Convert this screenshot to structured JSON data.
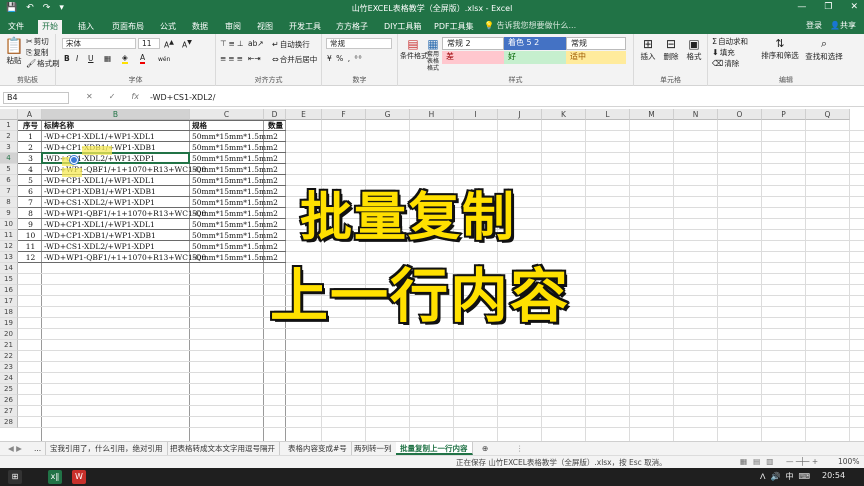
{
  "app": {
    "title": "山竹EXCEL表格教学（全屏版）.xlsx - Excel",
    "quick_access": [
      "💾",
      "↶",
      "↷",
      "▾"
    ],
    "window_controls": [
      "—",
      "❐",
      "✕"
    ]
  },
  "tabs": [
    "文件",
    "开始",
    "插入",
    "页面布局",
    "公式",
    "数据",
    "审阅",
    "视图",
    "开发工具",
    "方方格子",
    "DIY工具箱",
    "PDF工具集"
  ],
  "active_tab": "开始",
  "search_hint": "告诉我您想要做什么...",
  "account": {
    "login": "登录",
    "share": "共享"
  },
  "ribbon": {
    "clipboard": {
      "label": "剪贴板",
      "paste": "粘贴",
      "cut": "剪切",
      "copy": "复制",
      "format_painter": "格式刷"
    },
    "font": {
      "label": "字体",
      "name": "宋体",
      "size": "11",
      "bold": "B",
      "italic": "I",
      "underline": "U",
      "wen": "wén"
    },
    "alignment": {
      "label": "对齐方式",
      "wrap": "自动换行",
      "merge": "合并后居中"
    },
    "number": {
      "label": "数字",
      "format": "常规"
    },
    "styles": {
      "label": "样式",
      "conditional": "条件格式",
      "as_table": "套用表格格式",
      "cells": [
        {
          "text": "常规 2",
          "bg": "#ffffff",
          "fg": "#222222"
        },
        {
          "text": "着色 5 2",
          "bg": "#4472c4",
          "fg": "#ffffff"
        },
        {
          "text": "常规",
          "bg": "#ffffff",
          "fg": "#222222"
        },
        {
          "text": "差",
          "bg": "#ffc7ce",
          "fg": "#9c0006"
        },
        {
          "text": "好",
          "bg": "#c6efce",
          "fg": "#006100"
        },
        {
          "text": "适中",
          "bg": "#ffeb9c",
          "fg": "#9c5700"
        }
      ]
    },
    "cells_group": {
      "label": "单元格",
      "insert": "插入",
      "delete": "删除",
      "format": "格式"
    },
    "editing": {
      "label": "编辑",
      "autosum": "自动求和",
      "fill": "填充",
      "clear": "清除",
      "sort": "排序和筛选",
      "find": "查找和选择"
    }
  },
  "formula_bar": {
    "name_box": "B4",
    "cancel": "✕",
    "enter": "✓",
    "fx": "fx",
    "value": "-WD+CS1-XDL2/"
  },
  "columns": [
    "A",
    "B",
    "C",
    "D",
    "E",
    "F",
    "G",
    "H",
    "I",
    "J",
    "K",
    "L",
    "M",
    "N",
    "O",
    "P",
    "Q"
  ],
  "rows": [
    "1",
    "2",
    "3",
    "4",
    "5",
    "6",
    "7",
    "8",
    "9",
    "10",
    "11",
    "12",
    "13",
    "14",
    "15",
    "16",
    "17",
    "18",
    "19",
    "20",
    "21",
    "22",
    "23",
    "24",
    "25",
    "26",
    "27",
    "28"
  ],
  "table": {
    "headers": [
      "序号",
      "标牌名称",
      "规格",
      "数量"
    ],
    "rows": [
      [
        "1",
        "-WD+CP1-XDL1/+WP1-XDL1",
        "50mm*15mm*1.5mm",
        "2"
      ],
      [
        "2",
        "-WD+CP1-XDB1/+WP1-XDB1",
        "50mm*15mm*1.5mm",
        "2"
      ],
      [
        "3",
        "-WD+CS1-XDL2/+WP1-XDP1",
        "50mm*15mm*1.5mm",
        "2"
      ],
      [
        "4",
        "-WD+WP1-QBF1/+1+1070+R13+WC1-Q0",
        "50mm*15mm*1.5mm",
        "2"
      ],
      [
        "5",
        "-WD+CP1-XDL1/+WP1-XDL1",
        "50mm*15mm*1.5mm",
        "2"
      ],
      [
        "6",
        "-WD+CP1-XDB1/+WP1-XDB1",
        "50mm*15mm*1.5mm",
        "2"
      ],
      [
        "7",
        "-WD+CS1-XDL2/+WP1-XDP1",
        "50mm*15mm*1.5mm",
        "2"
      ],
      [
        "8",
        "-WD+WP1-QBF1/+1+1070+R13+WC1-Q0",
        "50mm*15mm*1.5mm",
        "2"
      ],
      [
        "9",
        "-WD+CP1-XDL1/+WP1-XDL1",
        "50mm*15mm*1.5mm",
        "2"
      ],
      [
        "10",
        "-WD+CP1-XDB1/+WP1-XDB1",
        "50mm*15mm*1.5mm",
        "2"
      ],
      [
        "11",
        "-WD+CS1-XDL2/+WP1-XDP1",
        "50mm*15mm*1.5mm",
        "2"
      ],
      [
        "12",
        "-WD+WP1-QBF1/+1+1070+R13+WC1-Q0",
        "50mm*15mm*1.5mm",
        "2"
      ]
    ]
  },
  "selected_cell": "B4",
  "overlay": {
    "line1": "批量复制",
    "line2": "上一行内容",
    "color": "#ffe000"
  },
  "sheet_tabs": [
    "...",
    "宝我引用了，什么引用，绝对引用",
    "把表格转成文本文字用逗号隔开",
    "表格内容变成#号",
    "两列转一列",
    "批量复制上一行内容"
  ],
  "active_sheet": "批量复制上一行内容",
  "status": {
    "message": "正在保存 山竹EXCEL表格教学（全屏版）.xlsx，按 Esc 取消。",
    "zoom": "100%"
  },
  "taskbar": {
    "apps": [
      "⊞",
      "x∥",
      "W"
    ],
    "time": "20:54",
    "tray": [
      "ᐱ",
      "🔊",
      "中",
      "⌨"
    ]
  }
}
